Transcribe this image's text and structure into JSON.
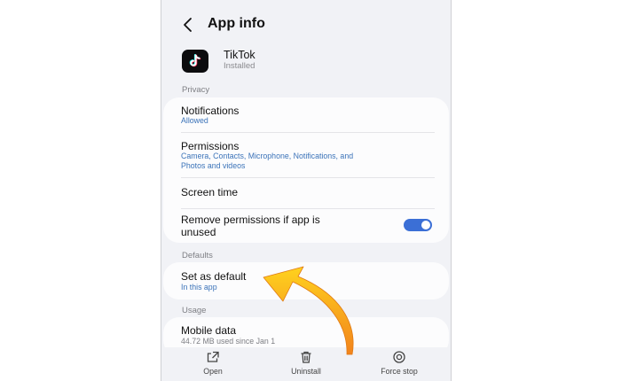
{
  "header": {
    "title": "App info"
  },
  "app": {
    "name": "TikTok",
    "status": "Installed"
  },
  "privacy": {
    "label": "Privacy",
    "notifications": {
      "title": "Notifications",
      "sub": "Allowed"
    },
    "permissions": {
      "title": "Permissions",
      "sub_line1": "Camera, Contacts, Microphone, Notifications, and",
      "sub_line2": "Photos and videos"
    },
    "screen_time": {
      "title": "Screen time"
    },
    "remove_permissions": {
      "title_line1": "Remove permissions if app is",
      "title_line2": "unused",
      "enabled": true
    }
  },
  "defaults": {
    "label": "Defaults",
    "set_as_default": {
      "title": "Set as default",
      "sub": "In this app"
    }
  },
  "usage": {
    "label": "Usage",
    "mobile_data": {
      "title": "Mobile data",
      "sub": "44.72 MB used since Jan 1"
    }
  },
  "bottom": {
    "open": "Open",
    "uninstall": "Uninstall",
    "force_stop": "Force stop"
  },
  "colors": {
    "accent": "#3b6fd6",
    "sub_text": "#3b73b9",
    "arrow_start": "#ffd21e",
    "arrow_end": "#f2831c"
  },
  "icons": {
    "back": "chevron-left-icon",
    "app": "tiktok-logo-icon",
    "open": "open-external-icon",
    "uninstall": "trash-icon",
    "force_stop": "force-stop-icon",
    "annotation": "curved-arrow-icon"
  }
}
